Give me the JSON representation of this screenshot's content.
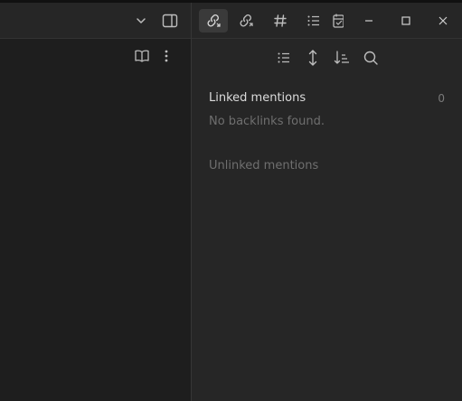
{
  "backlinks": {
    "linked_title": "Linked mentions",
    "linked_count": "0",
    "empty_message": "No backlinks found.",
    "unlinked_title": "Unlinked mentions"
  },
  "icons": {
    "left_titlebar": [
      "chevron-down-icon",
      "toggle-right-sidebar-icon"
    ],
    "left_pane_actions": [
      "reading-view-icon",
      "more-options-icon"
    ],
    "right_tabs": [
      "backlinks-icon",
      "outgoing-links-icon",
      "tags-icon",
      "outline-icon",
      "calendar-icon"
    ],
    "window_controls": [
      "minimize-icon",
      "maximize-icon",
      "close-icon"
    ],
    "backlinks_toolbar": [
      "list-view-icon",
      "expand-collapse-icon",
      "sort-icon",
      "search-icon"
    ]
  },
  "colors": {
    "background_left": "#1e1e1e",
    "background_right": "#262626",
    "text_primary": "#dcdcdc",
    "text_muted": "#6f6f6f"
  }
}
